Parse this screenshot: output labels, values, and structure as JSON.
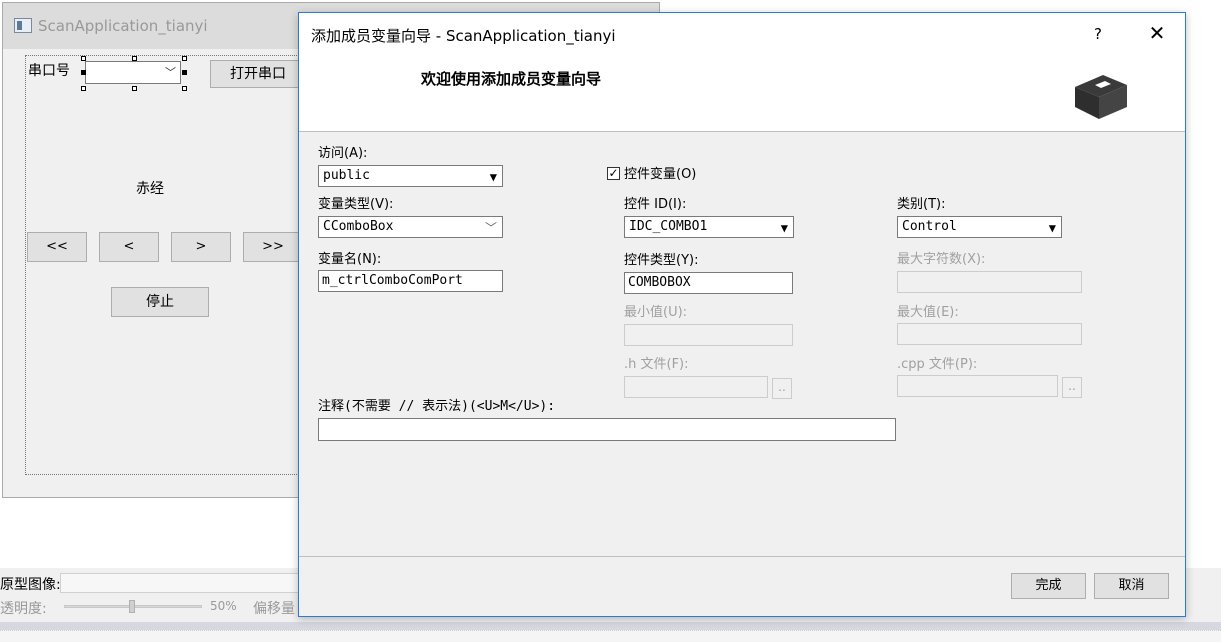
{
  "bg_window": {
    "title": "ScanApplication_tianyi",
    "port_label": "串口号",
    "open_port_button": "打开串口",
    "longitude_label": "赤经",
    "nav_buttons": [
      "<<",
      "<",
      ">",
      ">>"
    ],
    "stop_button": "停止"
  },
  "bottom": {
    "prototype_label": "原型图像:",
    "transparency_label": "透明度:",
    "transparency_value": "50%",
    "offset_label": "偏移量"
  },
  "wizard": {
    "title": "添加成员变量向导 - ScanApplication_tianyi",
    "help_glyph": "?",
    "close_glyph": "✕",
    "heading": "欢迎使用添加成员变量向导",
    "access_label": "访问(A):",
    "access_value": "public",
    "control_var_label": "控件变量(O)",
    "control_var_checked": true,
    "var_type_label": "变量类型(V):",
    "var_type_value": "CComboBox",
    "control_id_label": "控件 ID(I):",
    "control_id_value": "IDC_COMBO1",
    "category_label": "类别(T):",
    "category_value": "Control",
    "var_name_label": "变量名(N):",
    "var_name_value": "m_ctrlComboComPort",
    "control_type_label": "控件类型(Y):",
    "control_type_value": "COMBOBOX",
    "max_chars_label": "最大字符数(X):",
    "min_value_label": "最小值(U):",
    "max_value_label": "最大值(E):",
    "h_file_label": ".h 文件(F):",
    "cpp_file_label": ".cpp 文件(P):",
    "browse_label": "..",
    "comment_label": "注释(不需要 // 表示法)(<U>M</U>):",
    "comment_value": "",
    "finish_button": "完成",
    "cancel_button": "取消"
  }
}
